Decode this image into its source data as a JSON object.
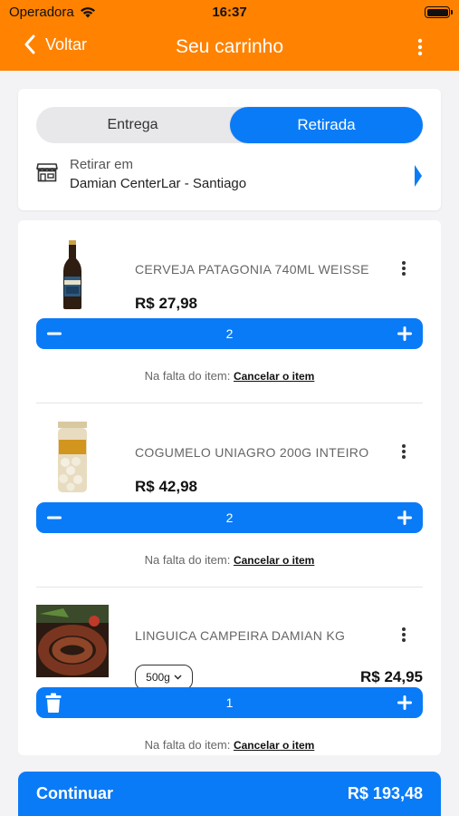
{
  "status_bar": {
    "carrier": "Operadora",
    "time": "16:37"
  },
  "nav": {
    "back_label": "Voltar",
    "title": "Seu carrinho"
  },
  "delivery_mode": {
    "options": [
      "Entrega",
      "Retirada"
    ],
    "selected": "Retirada",
    "pickup_label": "Retirar em",
    "pickup_store": "Damian CenterLar - Santiago"
  },
  "items": [
    {
      "name": "CERVEJA PATAGONIA 740ML WEISSE",
      "price": "R$ 27,98",
      "quantity": "2",
      "fallback_label": "Na falta do item:",
      "fallback_action": "Cancelar o item"
    },
    {
      "name": "COGUMELO UNIAGRO 200G INTEIRO",
      "price": "R$ 42,98",
      "quantity": "2",
      "fallback_label": "Na falta do item:",
      "fallback_action": "Cancelar o item"
    },
    {
      "name": "LINGUICA CAMPEIRA DAMIAN KG",
      "price": "R$ 24,95",
      "weight": "500g",
      "quantity": "1",
      "fallback_label": "Na falta do item:",
      "fallback_action": "Cancelar o item"
    }
  ],
  "footer": {
    "continue_label": "Continuar",
    "total": "R$ 193,48"
  },
  "colors": {
    "header": "#ff8200",
    "accent": "#0a7bf7"
  }
}
